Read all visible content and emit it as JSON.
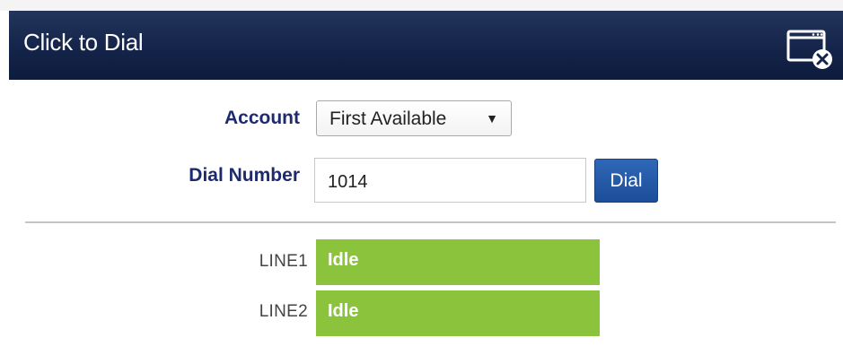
{
  "dialog": {
    "title": "Click to Dial",
    "close_icon": "window-close-icon"
  },
  "form": {
    "account_label": "Account",
    "account_selected": "First Available",
    "dial_number_label": "Dial Number",
    "dial_number_value": "1014",
    "dial_button_label": "Dial"
  },
  "lines": [
    {
      "label": "LINE1",
      "status": "Idle"
    },
    {
      "label": "LINE2",
      "status": "Idle"
    }
  ],
  "colors": {
    "title_bar": "#14244a",
    "label_text": "#1e2a6e",
    "dial_button": "#1c4e99",
    "status_idle": "#8bc43c"
  }
}
